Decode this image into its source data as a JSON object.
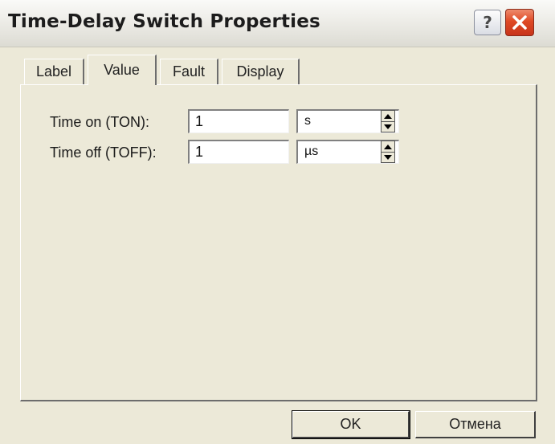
{
  "window": {
    "title": "Time-Delay Switch Properties",
    "help_label": "?"
  },
  "tabs": [
    {
      "label": "Label"
    },
    {
      "label": "Value"
    },
    {
      "label": "Fault"
    },
    {
      "label": "Display"
    }
  ],
  "active_tab": "Value",
  "fields": {
    "ton": {
      "label": "Time on (TON):",
      "value": "1",
      "unit": "s"
    },
    "toff": {
      "label": "Time off (TOFF):",
      "value": "1",
      "unit": "µs"
    }
  },
  "buttons": {
    "ok": "OK",
    "cancel": "Отмена"
  },
  "colors": {
    "dialog_bg": "#ece9d8",
    "close_button": "#df4a25"
  }
}
